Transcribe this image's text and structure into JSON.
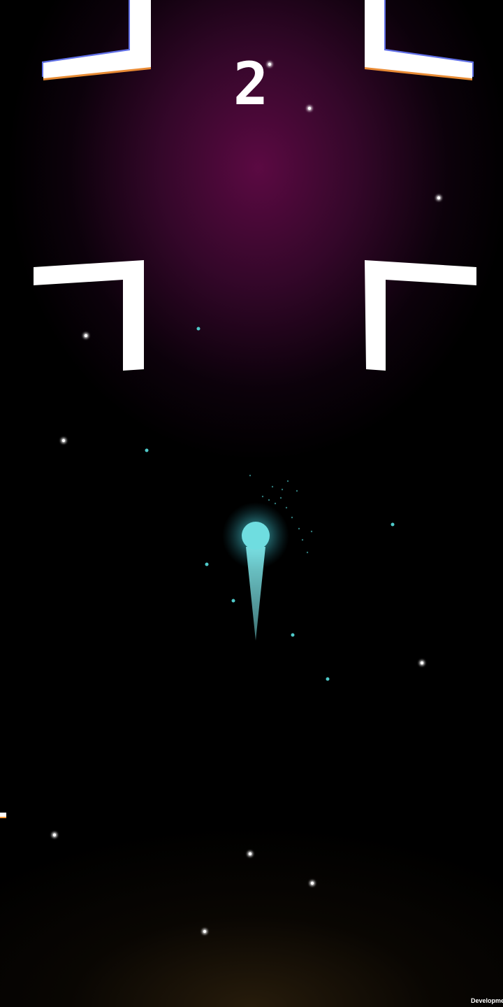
{
  "game": {
    "score": "2",
    "footer_text": "Development Build",
    "colors": {
      "background_top": "#5a0a46",
      "background_bottom": "#3a2a10",
      "wall": "#ffffff",
      "player": "#6fdde0",
      "particle": "#4fc9c9"
    }
  }
}
